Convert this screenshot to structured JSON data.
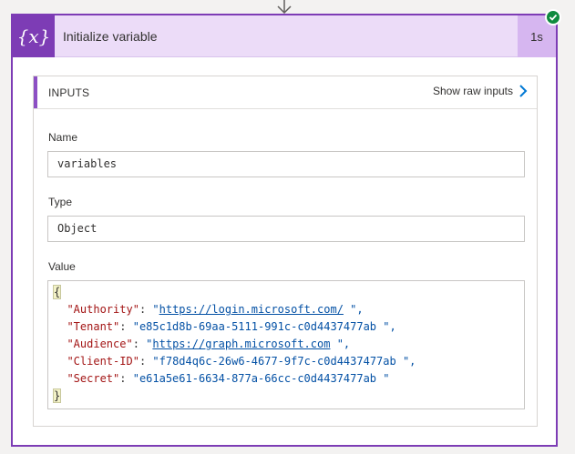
{
  "action": {
    "title": "Initialize variable",
    "duration": "1s",
    "icon": "variable-icon",
    "status": "succeeded",
    "status_color": "#0f8a3e",
    "accent_color": "#7d3cb5"
  },
  "inputs": {
    "header": "INPUTS",
    "show_raw_label": "Show raw inputs",
    "fields": {
      "name": {
        "label": "Name",
        "value": "variables"
      },
      "type": {
        "label": "Type",
        "value": "Object"
      },
      "value": {
        "label": "Value",
        "open_brace": "{",
        "close_brace": "}",
        "entries": [
          {
            "key": "\"Authority\"",
            "sep": ": ",
            "q1": "\"",
            "val": "https://login.microsoft.com/",
            "q2": " \",",
            "is_url": true
          },
          {
            "key": "\"Tenant\"",
            "sep": ": ",
            "q1": "\"",
            "val": "e85c1d8b-69aa-5111-991c-c0d4437477ab",
            "q2": " \",",
            "is_url": false
          },
          {
            "key": "\"Audience\"",
            "sep": ": ",
            "q1": "\"",
            "val": "https://graph.microsoft.com",
            "q2": " \",",
            "is_url": true
          },
          {
            "key": "\"Client-ID\"",
            "sep": ": ",
            "q1": "\"",
            "val": "f78d4q6c-26w6-4677-9f7c-c0d4437477ab",
            "q2": " \",",
            "is_url": false
          },
          {
            "key": "\"Secret\"",
            "sep": ": ",
            "q1": "\"",
            "val": "e61a5e61-6634-877a-66cc-c0d4437477ab",
            "q2": " \"",
            "is_url": false
          }
        ]
      }
    }
  }
}
